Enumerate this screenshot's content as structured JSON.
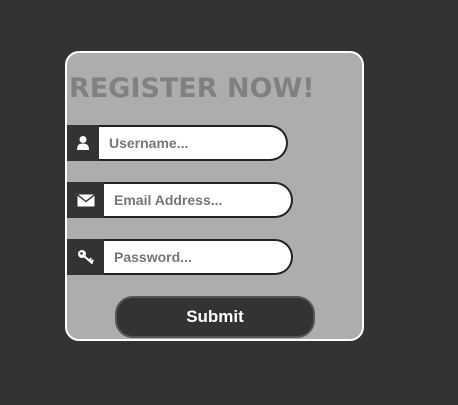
{
  "form": {
    "title": "REGISTER NOW!",
    "username": {
      "placeholder": "Username...",
      "icon": "user-icon"
    },
    "email": {
      "placeholder": "Email Address...",
      "icon": "envelope-icon"
    },
    "password": {
      "placeholder": "Password...",
      "icon": "key-icon"
    },
    "submit_label": "Submit"
  },
  "colors": {
    "page_background": "#333333",
    "card_background": "#adadad",
    "card_border": "#ffffff",
    "title": "#808080",
    "icon_box": "#333333",
    "button": "#333333",
    "button_text": "#ffffff"
  }
}
